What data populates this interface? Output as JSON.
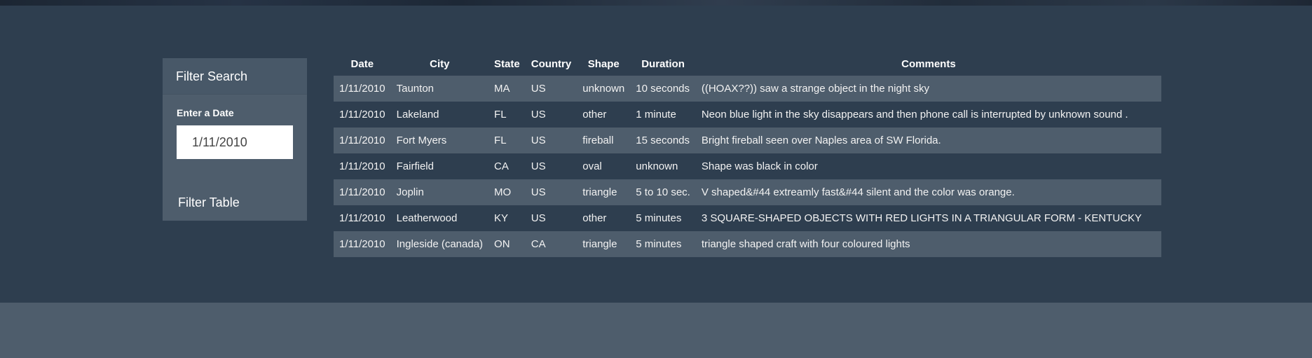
{
  "filter": {
    "heading": "Filter Search",
    "date_label": "Enter a Date",
    "date_value": "1/11/2010",
    "button_label": "Filter Table"
  },
  "table": {
    "headers": [
      "Date",
      "City",
      "State",
      "Country",
      "Shape",
      "Duration",
      "Comments"
    ],
    "rows": [
      [
        "1/11/2010",
        "Taunton",
        "MA",
        "US",
        "unknown",
        "10 seconds",
        "((HOAX??)) saw a strange object in the night sky"
      ],
      [
        "1/11/2010",
        "Lakeland",
        "FL",
        "US",
        "other",
        "1 minute",
        "Neon blue light in the sky disappears and then phone call is interrupted by unknown sound ."
      ],
      [
        "1/11/2010",
        "Fort Myers",
        "FL",
        "US",
        "fireball",
        "15 seconds",
        "Bright fireball seen over Naples area of SW Florida."
      ],
      [
        "1/11/2010",
        "Fairfield",
        "CA",
        "US",
        "oval",
        "unknown",
        "Shape was black in color"
      ],
      [
        "1/11/2010",
        "Joplin",
        "MO",
        "US",
        "triangle",
        "5 to 10 sec.",
        "V shaped&#44 extreamly fast&#44 silent and the color was orange."
      ],
      [
        "1/11/2010",
        "Leatherwood",
        "KY",
        "US",
        "other",
        "5 minutes",
        "3 SQUARE-SHAPED OBJECTS WITH RED LIGHTS IN A TRIANGULAR FORM - KENTUCKY"
      ],
      [
        "1/11/2010",
        "Ingleside (canada)",
        "ON",
        "CA",
        "triangle",
        "5 minutes",
        "triangle shaped craft with four coloured lights"
      ]
    ]
  },
  "colors": {
    "background": "#2e3e4f",
    "panel": "#4e5d6c",
    "stripe": "#4e5d6c",
    "text": "#ffffff"
  }
}
